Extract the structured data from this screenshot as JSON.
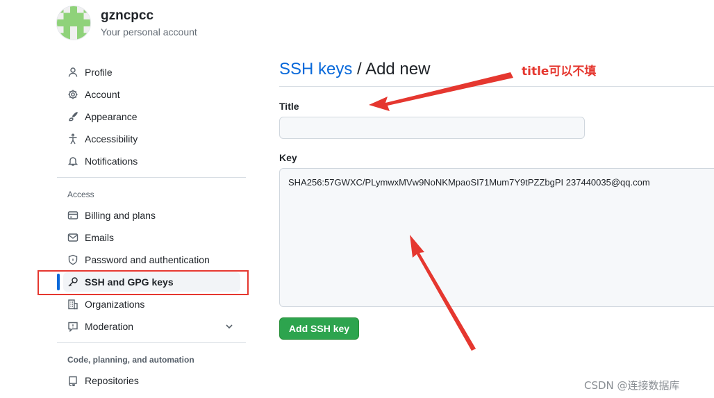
{
  "account": {
    "username": "gzncpcc",
    "subtitle": "Your personal account"
  },
  "sidebar": {
    "items": [
      {
        "label": "Profile",
        "icon": "person-icon"
      },
      {
        "label": "Account",
        "icon": "gear-icon"
      },
      {
        "label": "Appearance",
        "icon": "paintbrush-icon"
      },
      {
        "label": "Accessibility",
        "icon": "accessibility-icon"
      },
      {
        "label": "Notifications",
        "icon": "bell-icon"
      }
    ],
    "access_heading": "Access",
    "access_items": [
      {
        "label": "Billing and plans",
        "icon": "credit-card-icon"
      },
      {
        "label": "Emails",
        "icon": "mail-icon"
      },
      {
        "label": "Password and authentication",
        "icon": "shield-lock-icon"
      },
      {
        "label": "SSH and GPG keys",
        "icon": "key-icon",
        "active": true
      },
      {
        "label": "Organizations",
        "icon": "organization-icon"
      },
      {
        "label": "Moderation",
        "icon": "report-icon"
      }
    ],
    "code_heading": "Code, planning, and automation",
    "code_items": [
      {
        "label": "Repositories",
        "icon": "repo-icon"
      }
    ]
  },
  "main": {
    "breadcrumb": "SSH keys",
    "separator": "/",
    "title": "Add new",
    "title_label": "Title",
    "title_value": "",
    "key_label": "Key",
    "key_value": "SHA256:57GWXC/PLymwxMVw9NoNKMpaoSI71Mum7Y9tPZZbgPI 237440035@qq.com",
    "submit_label": "Add SSH key"
  },
  "annotation": {
    "note": "title可以不填",
    "color": "#e5372f"
  },
  "watermark": "CSDN @连接数据库",
  "colors": {
    "accent": "#0969da",
    "button": "#2da44e",
    "annotation": "#e5372f"
  }
}
